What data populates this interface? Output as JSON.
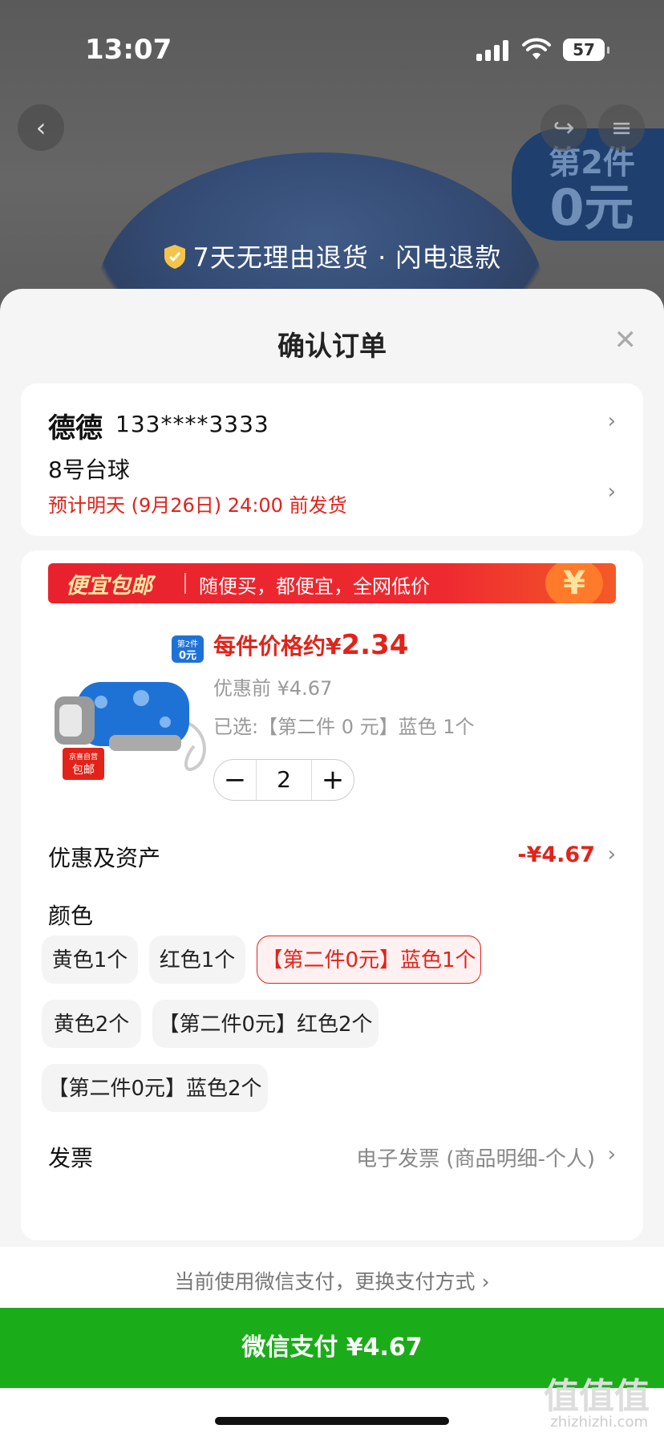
{
  "status": {
    "time": "13:07",
    "battery": "57"
  },
  "hero": {
    "guarantee": "7天无理由退货 · 闪电退款",
    "badge_l1": "第2件",
    "badge_l2": "0元"
  },
  "sheet": {
    "title": "确认订单"
  },
  "address": {
    "name": "德德",
    "phone": "133****3333",
    "place": "8号台球",
    "shipping": "预计明天 (9月26日) 24:00 前发货"
  },
  "promo": {
    "tag": "便宜包邮",
    "text": "随便买，都便宜，全网低价",
    "coin": "¥"
  },
  "product": {
    "thumb_badge_l1": "第2件",
    "thumb_badge_l2": "0元",
    "thumb_tag_l1": "京喜自营",
    "thumb_tag_l2": "包邮",
    "price_prefix": "每件价格约",
    "price_currency": "¥",
    "price_value": "2.34",
    "price_before": "优惠前 ¥4.67",
    "selected": "已选:【第二件 0 元】蓝色 1个",
    "quantity": "2",
    "minus": "−",
    "plus": "+"
  },
  "discount": {
    "label": "优惠及资产",
    "value": "-¥4.67"
  },
  "color": {
    "label": "颜色",
    "options": [
      "黄色1个",
      "红色1个",
      "【第二件0元】蓝色1个",
      "黄色2个",
      "【第二件0元】红色2个",
      "【第二件0元】蓝色2个"
    ],
    "selected_index": 2
  },
  "invoice": {
    "label": "发票",
    "value": "电子发票 (商品明细-个人)"
  },
  "payment": {
    "message": "当前使用微信支付，更换支付方式 ›",
    "button": "微信支付 ¥4.67"
  },
  "watermark": {
    "main": "值值值",
    "sub": "zhizhizhi.com"
  },
  "colors": {
    "accent_red": "#e2231a",
    "pay_green": "#1aad19"
  }
}
